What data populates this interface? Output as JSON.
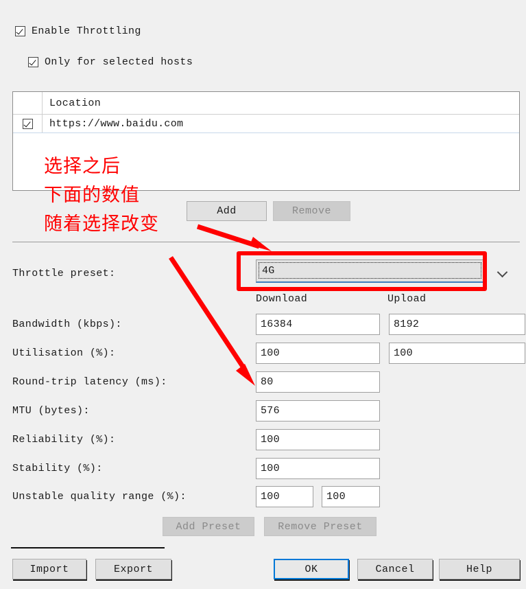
{
  "checkboxes": {
    "enable_throttling": {
      "label": "Enable Throttling",
      "checked": true
    },
    "only_selected_hosts": {
      "label": "Only for selected hosts",
      "checked": true
    }
  },
  "hosts_table": {
    "columns": [
      "",
      "Location"
    ],
    "header_location": "Location",
    "rows": [
      {
        "checked": true,
        "location": "https://www.baidu.com"
      }
    ]
  },
  "host_buttons": {
    "add": "Add",
    "remove": "Remove"
  },
  "preset": {
    "label": "Throttle preset:",
    "value": "4G",
    "chevron": "chevron-down-icon"
  },
  "columns": {
    "download": "Download",
    "upload": "Upload"
  },
  "fields": [
    {
      "label": "Bandwidth (kbps):",
      "download": "16384",
      "upload": "8192"
    },
    {
      "label": "Utilisation (%):",
      "download": "100",
      "upload": "100"
    },
    {
      "label": "Round-trip latency (ms):",
      "download": "80",
      "upload": null
    },
    {
      "label": "MTU (bytes):",
      "download": "576",
      "upload": null
    },
    {
      "label": "Reliability (%):",
      "download": "100",
      "upload": null
    },
    {
      "label": "Stability (%):",
      "download": "100",
      "upload": null
    }
  ],
  "unstable": {
    "label": "Unstable quality range (%):",
    "min": "100",
    "max": "100"
  },
  "preset_buttons": {
    "add_preset": "Add Preset",
    "remove_preset": "Remove Preset"
  },
  "footer_buttons": {
    "import": "Import",
    "export": "Export",
    "ok": "OK",
    "cancel": "Cancel",
    "help": "Help"
  },
  "annotations": {
    "line1": "选择之后",
    "line2": "下面的数值",
    "line3": "随着选择改变",
    "color": "#ff0000"
  }
}
